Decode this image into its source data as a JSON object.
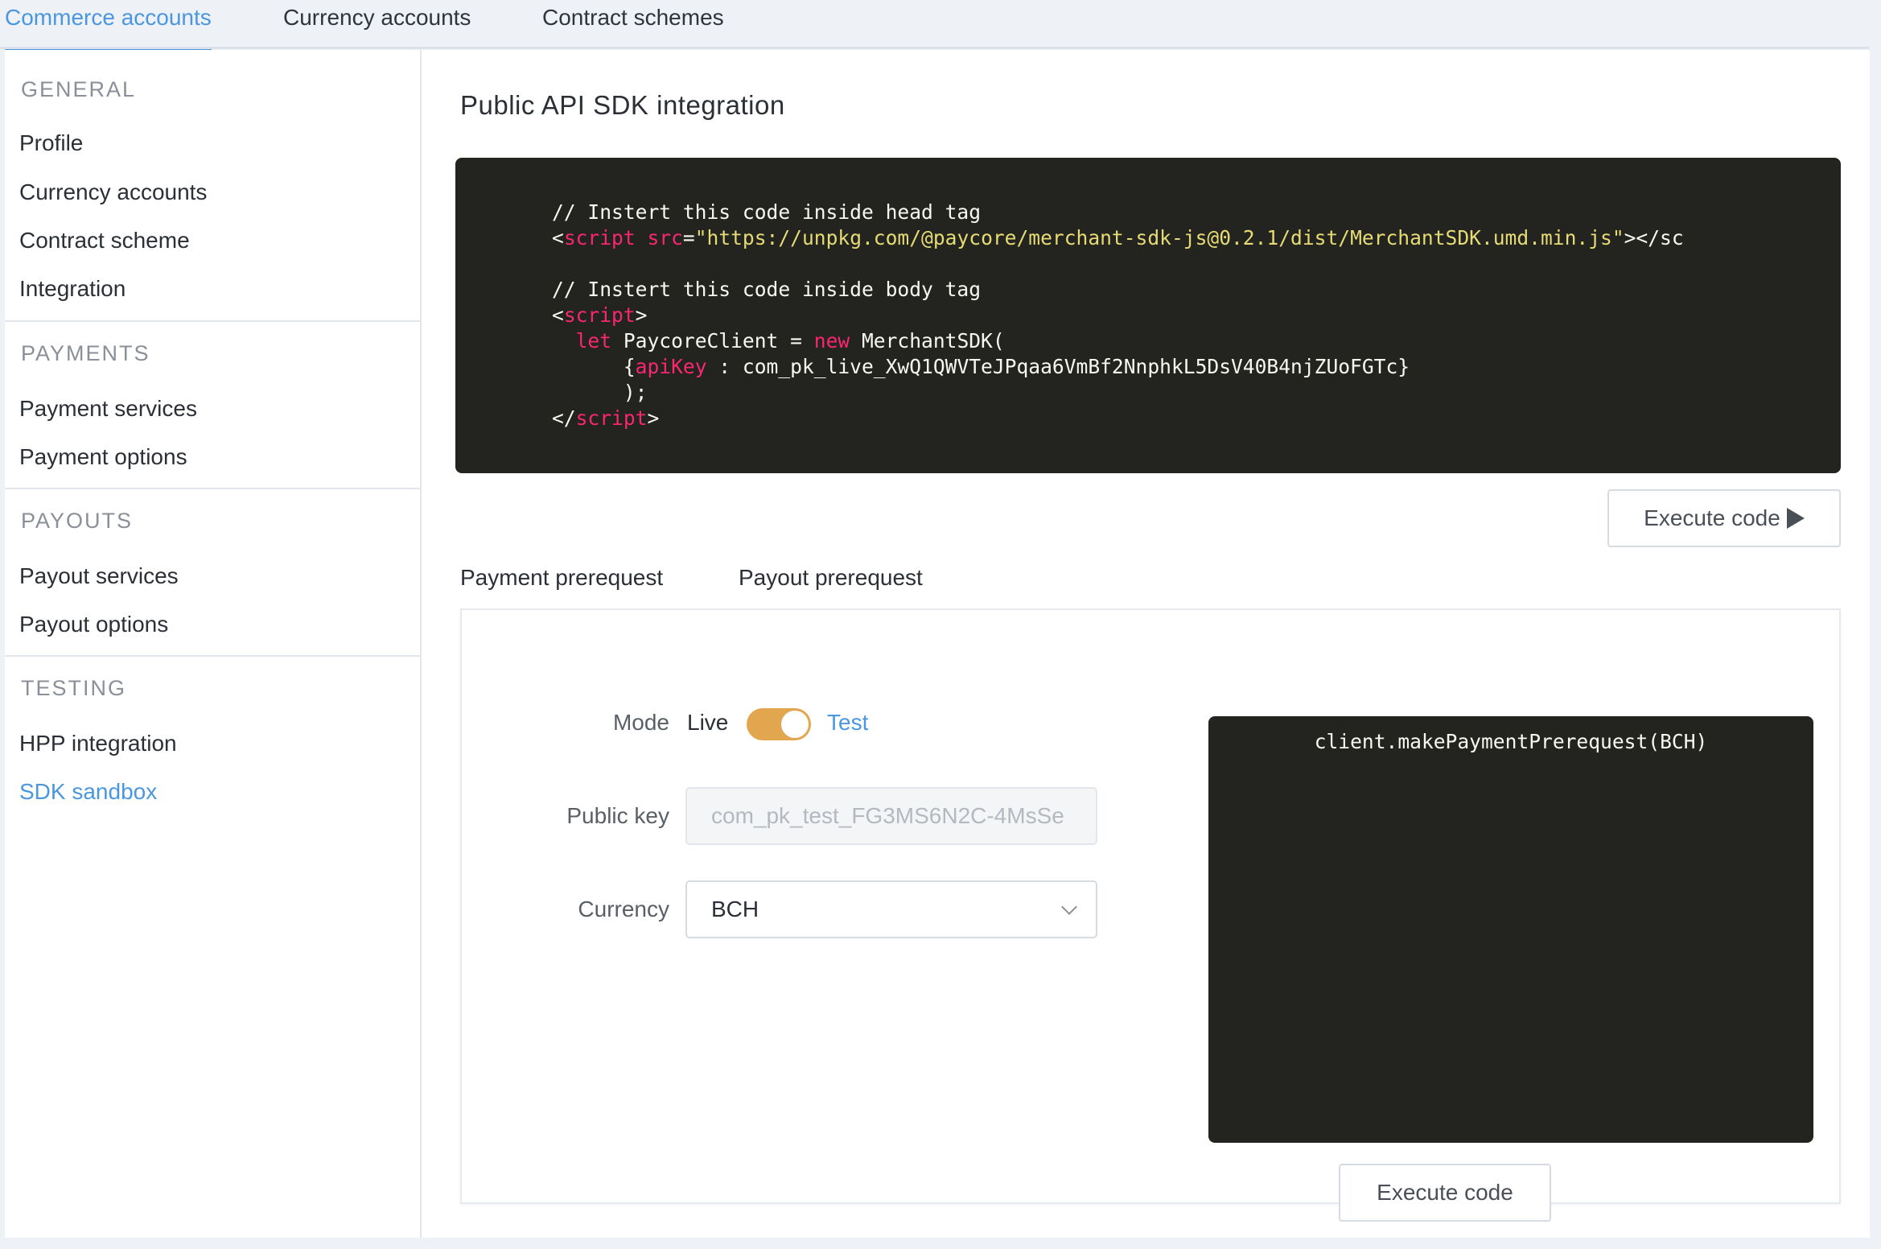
{
  "top_tabs": {
    "commerce": "Commerce accounts",
    "currency": "Currency accounts",
    "contract": "Contract schemes"
  },
  "sidebar": {
    "general": {
      "heading": "GENERAL",
      "items": [
        "Profile",
        "Currency accounts",
        "Contract scheme",
        "Integration"
      ]
    },
    "payments": {
      "heading": "PAYMENTS",
      "items": [
        "Payment services",
        "Payment options"
      ]
    },
    "payouts": {
      "heading": "PAYOUTS",
      "items": [
        "Payout services",
        "Payout options"
      ]
    },
    "testing": {
      "heading": "TESTING",
      "items": [
        "HPP integration",
        "SDK sandbox"
      ]
    },
    "active_item": "SDK sandbox"
  },
  "main": {
    "title": "Public API SDK integration",
    "code": {
      "comment_head": "// Instert this code inside head tag",
      "script_open_lt": "<",
      "script_kw": "script",
      "src_attr": "src",
      "src_eq": "=",
      "src_url": "\"https://unpkg.com/@paycore/merchant-sdk-js@0.2.1/dist/MerchantSDK.umd.min.js\"",
      "script_close_tail": "></sc",
      "comment_body": "// Instert this code inside body tag",
      "script_open_gt": ">",
      "let_kw": "let",
      "client_decl": " PaycoreClient = ",
      "new_kw": "new",
      "sdk_ctor": " MerchantSDK(",
      "brace_open": "{",
      "api_key_name": "apiKey",
      "api_key_value": " : com_pk_live_XwQ1QWVTeJPqaa6VmBf2NnphkL5DsV40B4njZUoFGTc}",
      "paren_close": ");",
      "script_end_lt": "</",
      "script_end_gt": ">"
    },
    "execute_button_label": "Execute code",
    "execute_button_icon": "play-icon"
  },
  "prereq": {
    "tabs": [
      "Payment prerequest",
      "Payout prerequest"
    ],
    "mode_label": "Mode",
    "mode_live": "Live",
    "mode_test": "Test",
    "mode_toggle_state": "test",
    "public_key_label": "Public key",
    "public_key_value": "com_pk_test_FG3MS6N2C-4MsSe",
    "currency_label": "Currency",
    "currency_value": "BCH",
    "preview_code": "client.makePaymentPrerequest(BCH)",
    "execute_button_label": "Execute code"
  },
  "colors": {
    "accent": "#4a97e0",
    "toggle": "#e2a74e",
    "code_bg": "#23241f",
    "code_keyword": "#f92672",
    "code_string": "#e6db74"
  }
}
